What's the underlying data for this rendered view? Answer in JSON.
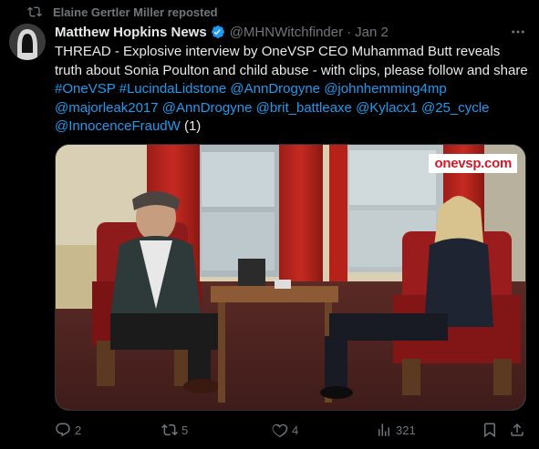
{
  "repost": {
    "text": "Elaine Gertler Miller reposted",
    "icon": "repost-icon"
  },
  "author": {
    "name": "Matthew Hopkins News",
    "handle": "@MHNWitchfinder",
    "separator": "·",
    "date": "Jan 2",
    "verified": true
  },
  "tweet": {
    "text_1": "THREAD - Explosive interview by OneVSP CEO Muhammad Butt reveals truth about Sonia Poulton and child abuse - with clips, please follow and share ",
    "tags": [
      "#OneVSP",
      "#LucindaLidstone",
      "@AnnDrogyne",
      "@johnhemming4mp",
      "@majorleak2017",
      "@AnnDrogyne",
      "@brit_battleaxe",
      "@Kylacx1",
      "@25_cycle",
      "@InnocenceFraudW"
    ],
    "suffix": "(1)"
  },
  "media": {
    "watermark": "onevsp.com"
  },
  "actions": {
    "replies": "2",
    "reposts": "5",
    "likes": "4",
    "views": "321"
  },
  "colors": {
    "accent": "#1d9bf0",
    "muted": "#71767b",
    "text": "#e7e9ea",
    "background": "#000000"
  }
}
